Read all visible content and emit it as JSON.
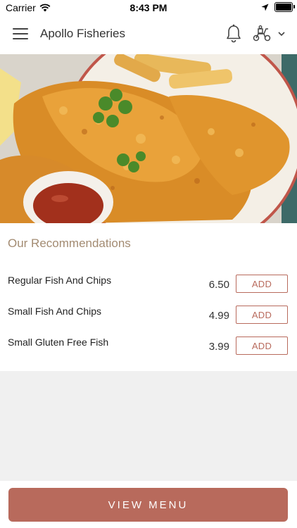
{
  "status_bar": {
    "carrier": "Carrier",
    "time": "8:43 PM"
  },
  "header": {
    "title": "Apollo Fisheries"
  },
  "icons": {
    "menu": "hamburger-icon",
    "notifications": "bell-icon",
    "delivery": "scooter-icon",
    "dropdown": "chevron-down-icon"
  },
  "recommendations": {
    "title": "Our Recommendations",
    "items": [
      {
        "name": "Regular Fish And Chips",
        "price": "6.50",
        "add_label": "ADD"
      },
      {
        "name": "Small Fish And Chips",
        "price": "4.99",
        "add_label": "ADD"
      },
      {
        "name": "Small Gluten Free Fish",
        "price": "3.99",
        "add_label": "ADD"
      }
    ]
  },
  "footer": {
    "view_menu_label": "VIEW MENU"
  },
  "colors": {
    "accent": "#b86a5c",
    "section_title": "#a38b72",
    "background": "#f0f0f0"
  }
}
